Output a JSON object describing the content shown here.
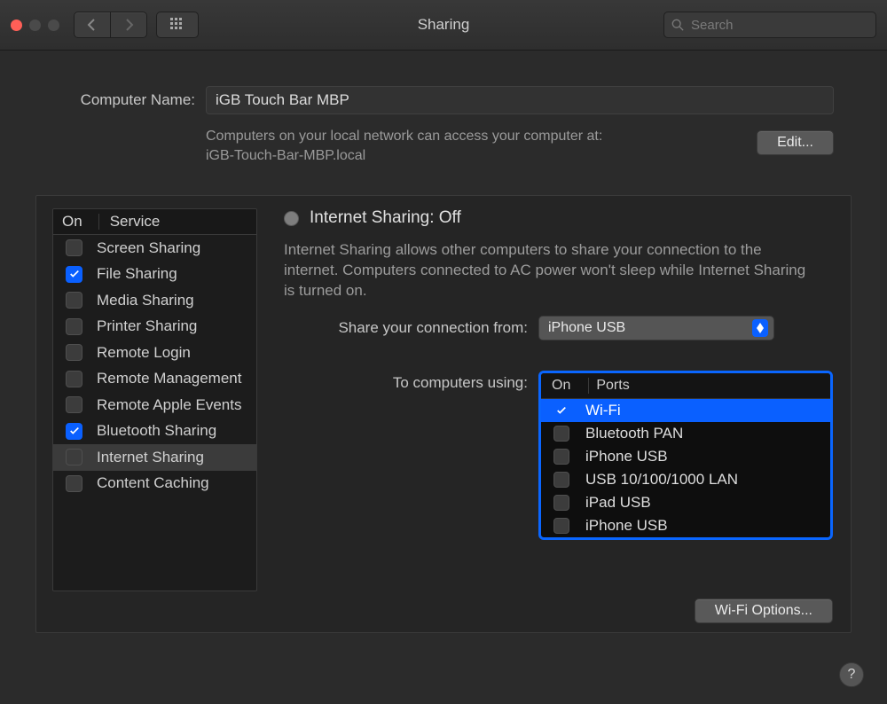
{
  "window": {
    "title": "Sharing"
  },
  "toolbar": {
    "search_placeholder": "Search"
  },
  "computer_name": {
    "label": "Computer Name:",
    "value": "iGB Touch Bar MBP",
    "subtext_line1": "Computers on your local network can access your computer at:",
    "subtext_line2": "iGB-Touch-Bar-MBP.local",
    "edit_label": "Edit..."
  },
  "services_table": {
    "col_on": "On",
    "col_service": "Service",
    "rows": [
      {
        "label": "Screen Sharing",
        "checked": false,
        "selected": false
      },
      {
        "label": "File Sharing",
        "checked": true,
        "selected": false
      },
      {
        "label": "Media Sharing",
        "checked": false,
        "selected": false
      },
      {
        "label": "Printer Sharing",
        "checked": false,
        "selected": false
      },
      {
        "label": "Remote Login",
        "checked": false,
        "selected": false
      },
      {
        "label": "Remote Management",
        "checked": false,
        "selected": false
      },
      {
        "label": "Remote Apple Events",
        "checked": false,
        "selected": false
      },
      {
        "label": "Bluetooth Sharing",
        "checked": true,
        "selected": false
      },
      {
        "label": "Internet Sharing",
        "checked": false,
        "selected": true
      },
      {
        "label": "Content Caching",
        "checked": false,
        "selected": false
      }
    ]
  },
  "detail": {
    "title": "Internet Sharing: Off",
    "description": "Internet Sharing allows other computers to share your connection to the internet. Computers connected to AC power won't sleep while Internet Sharing is turned on.",
    "share_from_label": "Share your connection from:",
    "share_from_value": "iPhone USB",
    "to_computers_label": "To computers using:",
    "ports_table": {
      "col_on": "On",
      "col_ports": "Ports",
      "rows": [
        {
          "label": "Wi-Fi",
          "checked": true,
          "selected": true
        },
        {
          "label": "Bluetooth PAN",
          "checked": false,
          "selected": false
        },
        {
          "label": "iPhone USB",
          "checked": false,
          "selected": false
        },
        {
          "label": "USB 10/100/1000 LAN",
          "checked": false,
          "selected": false
        },
        {
          "label": "iPad USB",
          "checked": false,
          "selected": false
        },
        {
          "label": "iPhone USB",
          "checked": false,
          "selected": false
        }
      ]
    },
    "wifi_options_label": "Wi-Fi Options..."
  },
  "help_glyph": "?"
}
